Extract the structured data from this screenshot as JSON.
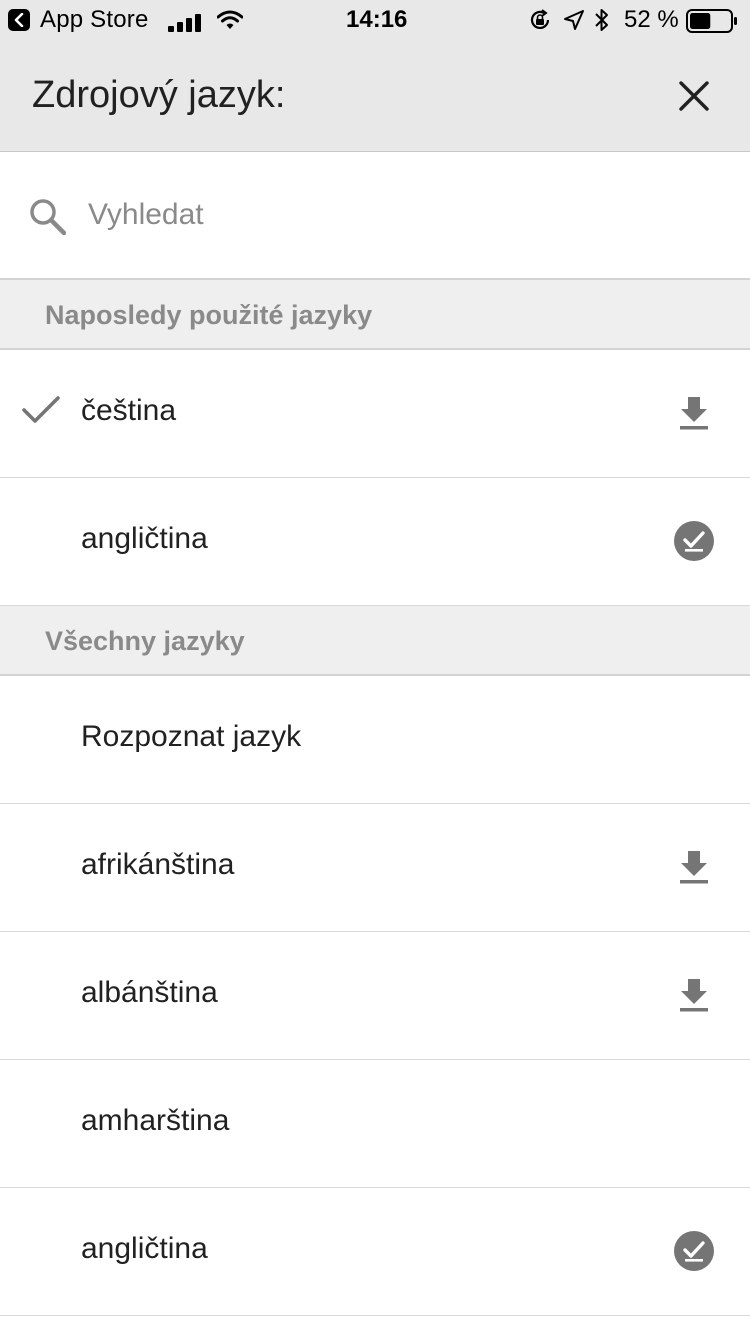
{
  "status_bar": {
    "back_app": "App Store",
    "time": "14:16",
    "battery_percent": "52 %",
    "battery_level": 0.52
  },
  "header": {
    "title": "Zdrojový jazyk:",
    "close_icon": "close-icon"
  },
  "search": {
    "placeholder": "Vyhledat",
    "value": ""
  },
  "sections": {
    "recent": {
      "title": "Naposledy použité jazyky",
      "items": [
        {
          "label": "čeština",
          "selected": true,
          "status": "download"
        },
        {
          "label": "angličtina",
          "selected": false,
          "status": "downloaded"
        }
      ]
    },
    "all": {
      "title": "Všechny jazyky",
      "items": [
        {
          "label": "Rozpoznat jazyk",
          "status": "none"
        },
        {
          "label": "afrikánština",
          "status": "download"
        },
        {
          "label": "albánština",
          "status": "download"
        },
        {
          "label": "amharština",
          "status": "none"
        },
        {
          "label": "angličtina",
          "status": "downloaded"
        }
      ]
    }
  },
  "icons": {
    "download": "download-icon",
    "downloaded": "downloaded-check-circle-icon",
    "selected": "checkmark-icon",
    "search": "search-icon"
  },
  "colors": {
    "header_bg": "#e8e8e8",
    "section_bg": "#efefef",
    "icon_gray": "#757575",
    "text": "#212121",
    "muted_text": "#8a8a8a"
  }
}
